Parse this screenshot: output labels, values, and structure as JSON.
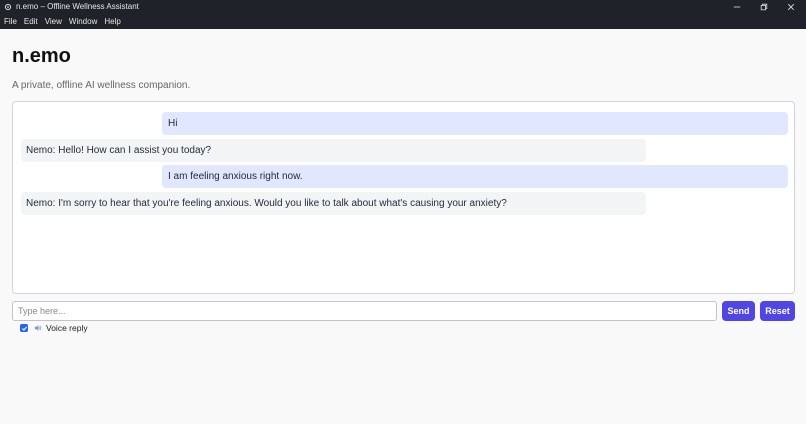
{
  "window": {
    "title": "n.emo – Offline Wellness Assistant",
    "app_icon": "gear-icon",
    "controls": [
      "minimize-icon",
      "restore-icon",
      "close-icon"
    ]
  },
  "menu": [
    "File",
    "Edit",
    "View",
    "Window",
    "Help"
  ],
  "app": {
    "title": "n.emo",
    "subtitle": "A private, offline AI wellness companion."
  },
  "messages": [
    {
      "role": "user",
      "text": "Hi"
    },
    {
      "role": "assistant",
      "text": "Nemo: Hello! How can I assist you today?"
    },
    {
      "role": "user",
      "text": "I am feeling anxious right now."
    },
    {
      "role": "assistant",
      "text": "Nemo: I'm sorry to hear that you're feeling anxious. Would you like to talk about what's causing your anxiety?"
    }
  ],
  "composer": {
    "placeholder": "Type here...",
    "send_label": "Send",
    "reset_label": "Reset"
  },
  "voice": {
    "checked": true,
    "icon": "speaker-icon",
    "label": "Voice reply"
  },
  "colors": {
    "accent": "#4f46e5",
    "user_bubble": "#e0e7ff",
    "assistant_bubble": "#f3f4f6",
    "titlebar": "#1f2329"
  }
}
